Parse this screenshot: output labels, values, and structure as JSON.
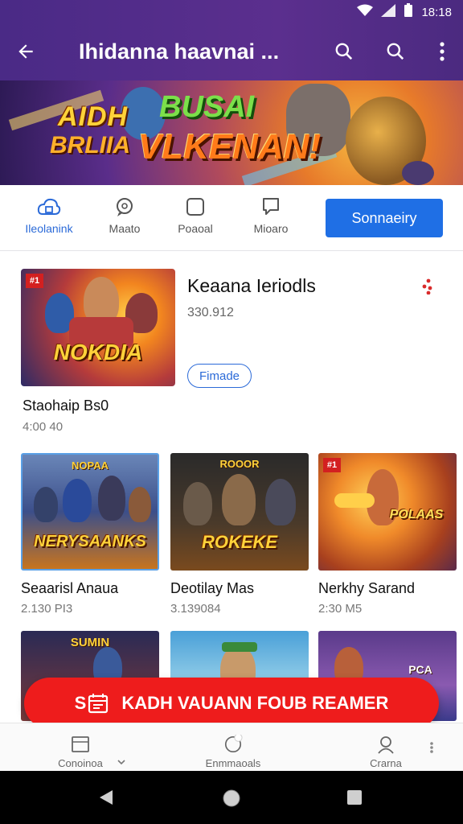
{
  "status_bar": {
    "time": "18:18"
  },
  "toolbar": {
    "title": "Ihidanna haavnai ..."
  },
  "banner": {
    "text_line1": "AIDH",
    "text_line2": "BRLIIA",
    "text_line3": "BUSAI",
    "text_line4": "VLKENAN!"
  },
  "tabs": [
    {
      "label": "Ileolanink",
      "icon": "cloud-home-icon",
      "active": true
    },
    {
      "label": "Maato",
      "icon": "chat-bubble-icon",
      "active": false
    },
    {
      "label": "Poaoal",
      "icon": "square-icon",
      "active": false
    },
    {
      "label": "Mioaro",
      "icon": "message-icon",
      "active": false
    }
  ],
  "primary_button": {
    "label": "Sonnaeiry"
  },
  "featured": {
    "title": "Keaana Ieriodls",
    "meta": "330.912",
    "chip": "Fimade",
    "name": "Staohaip Bs0",
    "sub": "4:00 40",
    "art_label": "NOKDIA",
    "badge": "#1"
  },
  "grid": [
    {
      "title": "Seaarisl Anaua",
      "sub": "2.130 PI3",
      "art_label": "NERYSAANKS",
      "art_top": "NOPAA"
    },
    {
      "title": "Deotilay Mas",
      "sub": "3.139084",
      "art_label": "ROKEKE",
      "art_top": "ROOOR"
    },
    {
      "title": "Nerkhy Sarand",
      "sub": "2:30 M5",
      "art_label": "POLAAS",
      "art_top": "#1"
    }
  ],
  "row3": [
    {
      "art_top": "SUMIN"
    },
    {
      "art_top": ""
    },
    {
      "art_top": "PCA"
    }
  ],
  "cta": {
    "label": "KADH VAUANN FOUB REAMER",
    "prefix": "S"
  },
  "bottom_nav": [
    {
      "label": "Conoinoa",
      "icon": "window-icon"
    },
    {
      "label": "Enmmaoals",
      "icon": "circle-icon"
    },
    {
      "label": "Crarna",
      "icon": "person-icon"
    }
  ],
  "colors": {
    "accent": "#1f6fe5",
    "toolbar": "#4f2c88",
    "cta": "#ee1c1c"
  }
}
